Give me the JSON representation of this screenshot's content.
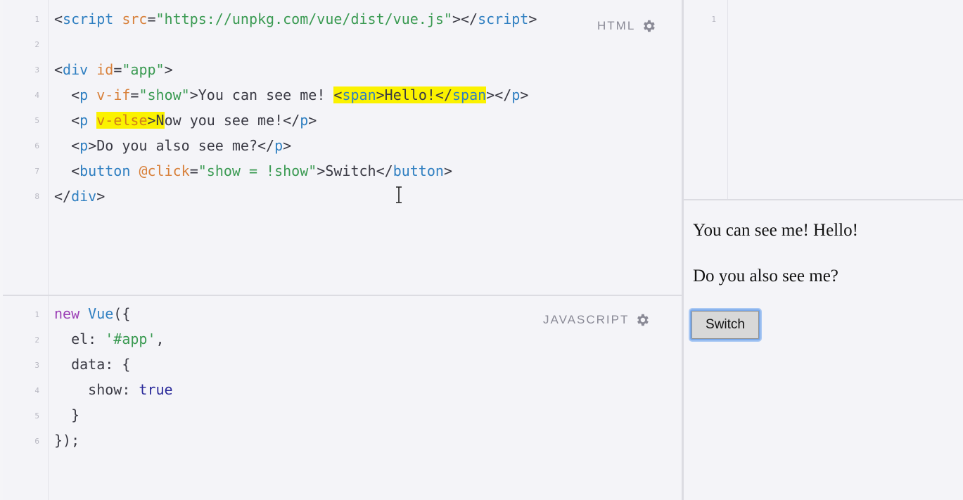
{
  "html_panel": {
    "label": "HTML",
    "line_numbers": [
      "1",
      "2",
      "3",
      "4",
      "5",
      "6",
      "7",
      "8"
    ],
    "code": {
      "l1": {
        "open": "<",
        "tag": "script",
        "attr": "src",
        "eq": "=",
        "val": "\"https://unpkg.com/vue/dist/vue.js\"",
        "mid": "></",
        "tag2": "script",
        "close": ">"
      },
      "l3": {
        "open": "<",
        "tag": "div",
        "attr": "id",
        "eq": "=",
        "val": "\"app\"",
        "close": ">"
      },
      "l4": {
        "indent": "  ",
        "open": "<",
        "tag": "p",
        "attr": "v-if",
        "eq": "=",
        "val": "\"show\"",
        "text": ">You can see me! ",
        "hl_open": "<",
        "hl_tag": "span",
        "hl_text": ">Hello!</",
        "hl_tag2": "span",
        "after_hl": ">",
        "close_open": "</",
        "close_tag": "p",
        "close": ">"
      },
      "l5": {
        "indent": "  ",
        "open": "<",
        "tag": "p",
        "sp": " ",
        "hl_attr": "v-else",
        "hl_gt": ">N",
        "text": "ow you see me!</",
        "close_tag": "p",
        "close": ">"
      },
      "l6": {
        "indent": "  ",
        "open": "<",
        "tag": "p",
        "text": ">Do you also see me?</",
        "close_tag": "p",
        "close": ">"
      },
      "l7": {
        "indent": "  ",
        "open": "<",
        "tag": "button",
        "attr": "@click",
        "eq": "=",
        "val": "\"show = !show\"",
        "text": ">Switch</",
        "close_tag": "button",
        "close": ">"
      },
      "l8": {
        "open": "</",
        "tag": "div",
        "close": ">"
      }
    }
  },
  "js_panel": {
    "label": "JAVASCRIPT",
    "line_numbers": [
      "1",
      "2",
      "3",
      "4",
      "5",
      "6"
    ],
    "code": {
      "l1": {
        "kw": "new",
        "fn": "Vue",
        "rest": "({"
      },
      "l2": {
        "text": "  el: ",
        "str": "'#app'",
        "rest": ","
      },
      "l3": {
        "text": "  data: {"
      },
      "l4": {
        "text": "    show: ",
        "bool": "true"
      },
      "l5": {
        "text": "  }"
      },
      "l6": {
        "text": "});"
      }
    }
  },
  "css_panel": {
    "line_numbers": [
      "1"
    ]
  },
  "result": {
    "p1": "You can see me! Hello!",
    "p2": "Do you also see me?",
    "button": "Switch"
  },
  "icons": {
    "settings": "gear-icon",
    "cursor": "text-cursor-icon"
  },
  "colors": {
    "highlight": "#fbf200",
    "tag": "#2f7fc1",
    "attr": "#d8803a",
    "string": "#3a9a52",
    "keyword": "#9b3fb5"
  }
}
